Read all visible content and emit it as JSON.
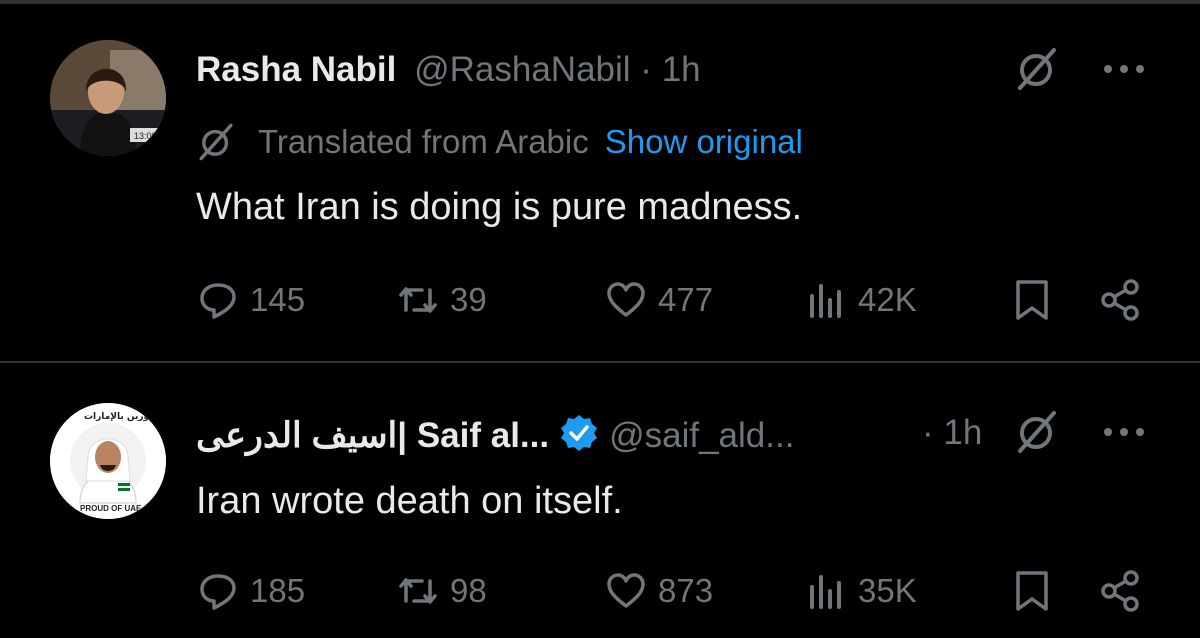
{
  "tweets": [
    {
      "name": "Rasha Nabil",
      "handle": "@RashaNabil",
      "separator": "·",
      "time": "1h",
      "translated_label": "Translated from Arabic",
      "show_original": "Show original",
      "text": "What Iran is doing is pure madness.",
      "replies": "145",
      "reposts": "39",
      "likes": "477",
      "views": "42K",
      "avatar_text": [
        "13:00"
      ]
    },
    {
      "name": "اسيف الدرعى| Saif al...",
      "handle": "@saif_ald...",
      "separator": "·",
      "time": "1h",
      "text": "Iran wrote death on itself.",
      "replies": "185",
      "reposts": "98",
      "likes": "873",
      "views": "35K",
      "avatar_text": [
        "PROUD OF UAE",
        "فخورين بالإمارات"
      ]
    }
  ],
  "colors": {
    "background": "#000000",
    "primary_text": "#e7e9ea",
    "secondary_text": "#71767b",
    "link": "#1d9bf0",
    "verified": "#1d9bf0",
    "divider": "#2f3336"
  },
  "icons": [
    "grok-icon",
    "more-icon",
    "reply-icon",
    "repost-icon",
    "like-icon",
    "views-icon",
    "bookmark-icon",
    "share-icon",
    "verified-badge-icon",
    "translate-icon"
  ]
}
